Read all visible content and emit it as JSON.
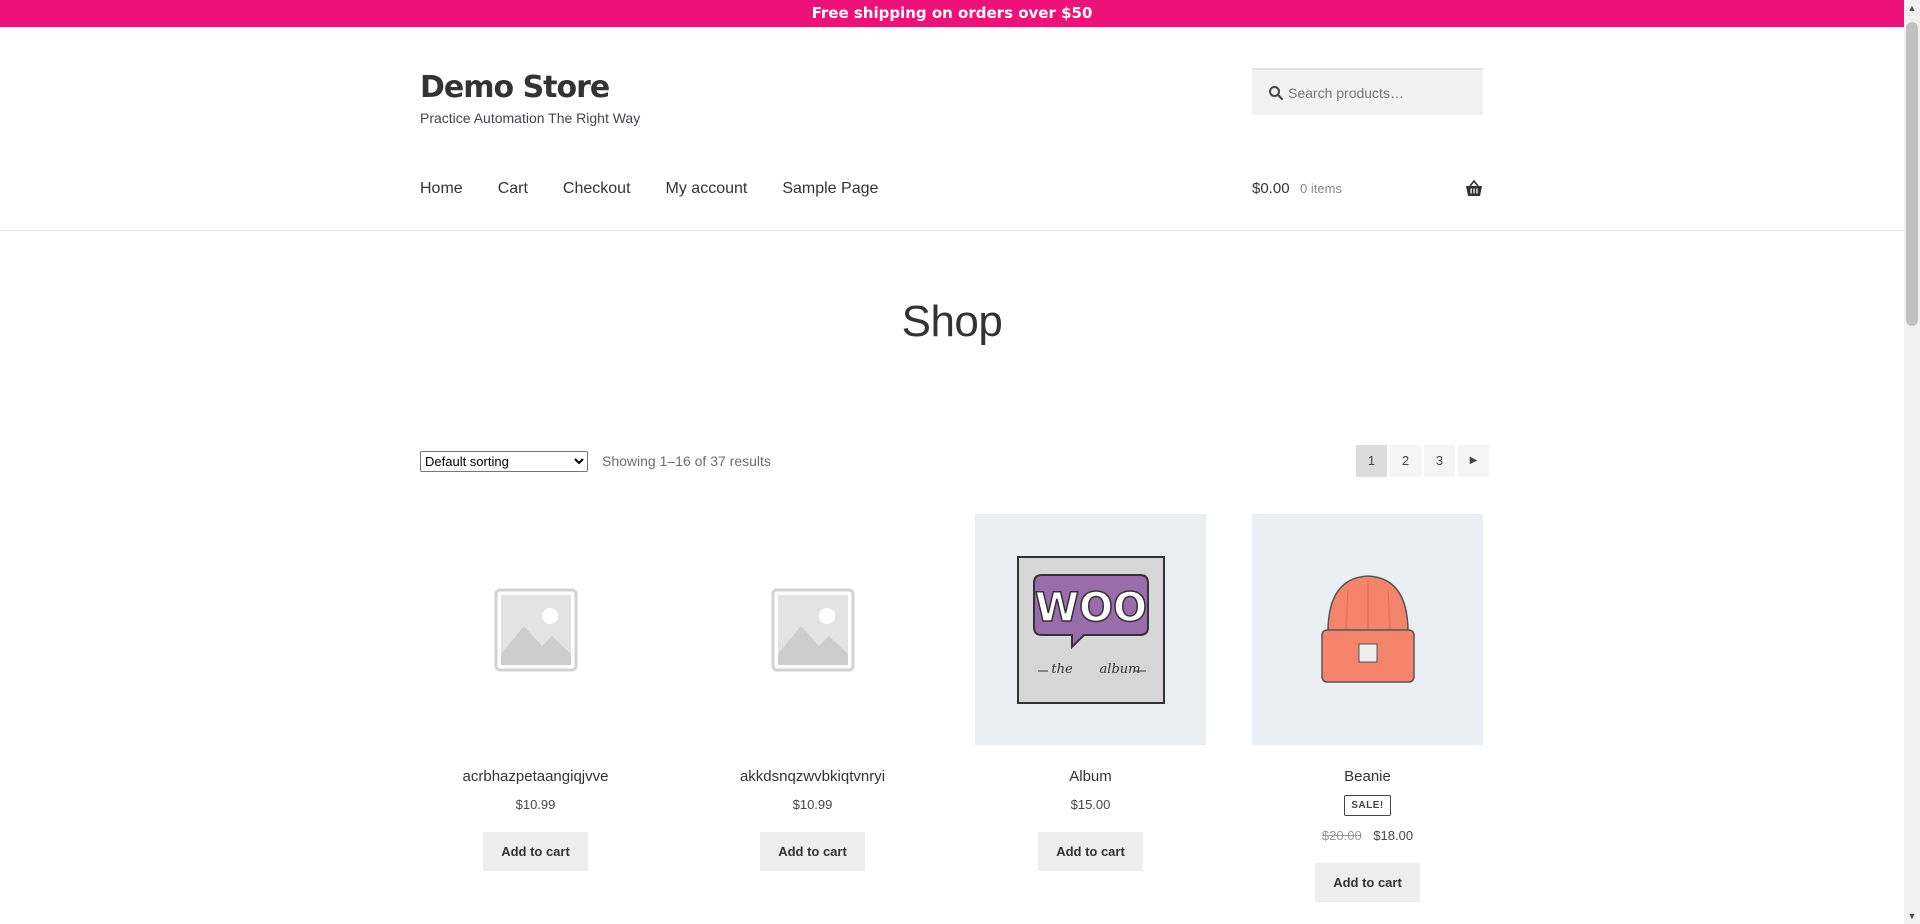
{
  "promo": {
    "text": "Free shipping on orders over $50"
  },
  "site": {
    "title": "Demo Store",
    "tagline": "Practice Automation The Right Way"
  },
  "search": {
    "placeholder": "Search products…"
  },
  "nav": {
    "items": [
      "Home",
      "Cart",
      "Checkout",
      "My account",
      "Sample Page"
    ]
  },
  "cart": {
    "total": "$0.00",
    "count": "0 items"
  },
  "page": {
    "title": "Shop"
  },
  "sorting": {
    "selected": "Default sorting"
  },
  "results": {
    "text": "Showing 1–16 of 37 results"
  },
  "pagination": {
    "pages": [
      "1",
      "2",
      "3"
    ],
    "current": "1"
  },
  "products": [
    {
      "name": "acrbhazpetaangiqjvve",
      "price": "$10.99",
      "button": "Add to cart"
    },
    {
      "name": "akkdsnqzwvbkiqtvnryi",
      "price": "$10.99",
      "button": "Add to cart"
    },
    {
      "name": "Album",
      "price": "$15.00",
      "button": "Add to cart"
    },
    {
      "name": "Beanie",
      "badge": "SALE!",
      "old_price": "$20.00",
      "price": "$18.00",
      "button": "Add to cart"
    }
  ],
  "album_art": {
    "logo": "WOO",
    "caption_left": "the",
    "caption_right": "album"
  },
  "colors": {
    "promo": "#ee117a",
    "beanie": "#f4846c"
  }
}
